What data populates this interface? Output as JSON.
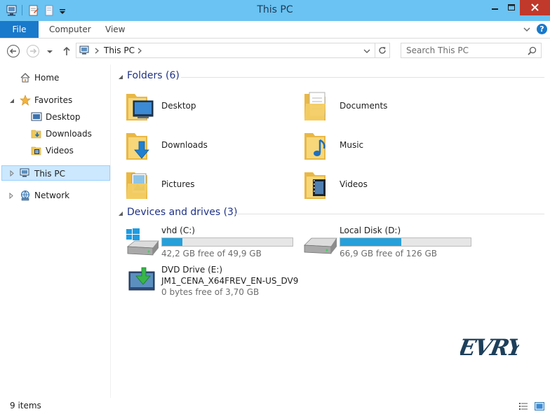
{
  "window": {
    "title": "This PC"
  },
  "ribbon": {
    "file_label": "File",
    "tabs": [
      {
        "label": "Computer"
      },
      {
        "label": "View"
      }
    ],
    "help_label": "?"
  },
  "address": {
    "path": "This PC"
  },
  "search": {
    "placeholder": "Search This PC"
  },
  "nav_pane": {
    "home": "Home",
    "favorites": "Favorites",
    "favorites_items": [
      {
        "label": "Desktop"
      },
      {
        "label": "Downloads"
      },
      {
        "label": "Videos"
      }
    ],
    "this_pc": "This PC",
    "network": "Network"
  },
  "folders_group": {
    "title": "Folders (6)",
    "items": [
      {
        "label": "Desktop",
        "icon": "desktop-folder-icon"
      },
      {
        "label": "Documents",
        "icon": "documents-folder-icon"
      },
      {
        "label": "Downloads",
        "icon": "downloads-folder-icon"
      },
      {
        "label": "Music",
        "icon": "music-folder-icon"
      },
      {
        "label": "Pictures",
        "icon": "pictures-folder-icon"
      },
      {
        "label": "Videos",
        "icon": "videos-folder-icon"
      }
    ]
  },
  "drives_group": {
    "title": "Devices and drives (3)",
    "items": [
      {
        "name": "vhd (C:)",
        "free": "42,2 GB free of 49,9 GB",
        "used_fraction": 0.154
      },
      {
        "name": "Local Disk (D:)",
        "free": "66,9 GB free of 126 GB",
        "used_fraction": 0.469
      },
      {
        "name": "DVD Drive (E:)",
        "label": "JM1_CENA_X64FREV_EN-US_DV9",
        "free": "0 bytes free of 3,70 GB"
      }
    ]
  },
  "status": {
    "item_count": "9 items"
  },
  "colors": {
    "titlebar": "#6ac3f2",
    "accent": "#1979ca",
    "bar_fill": "#26a0da",
    "group_title": "#1e3287"
  }
}
